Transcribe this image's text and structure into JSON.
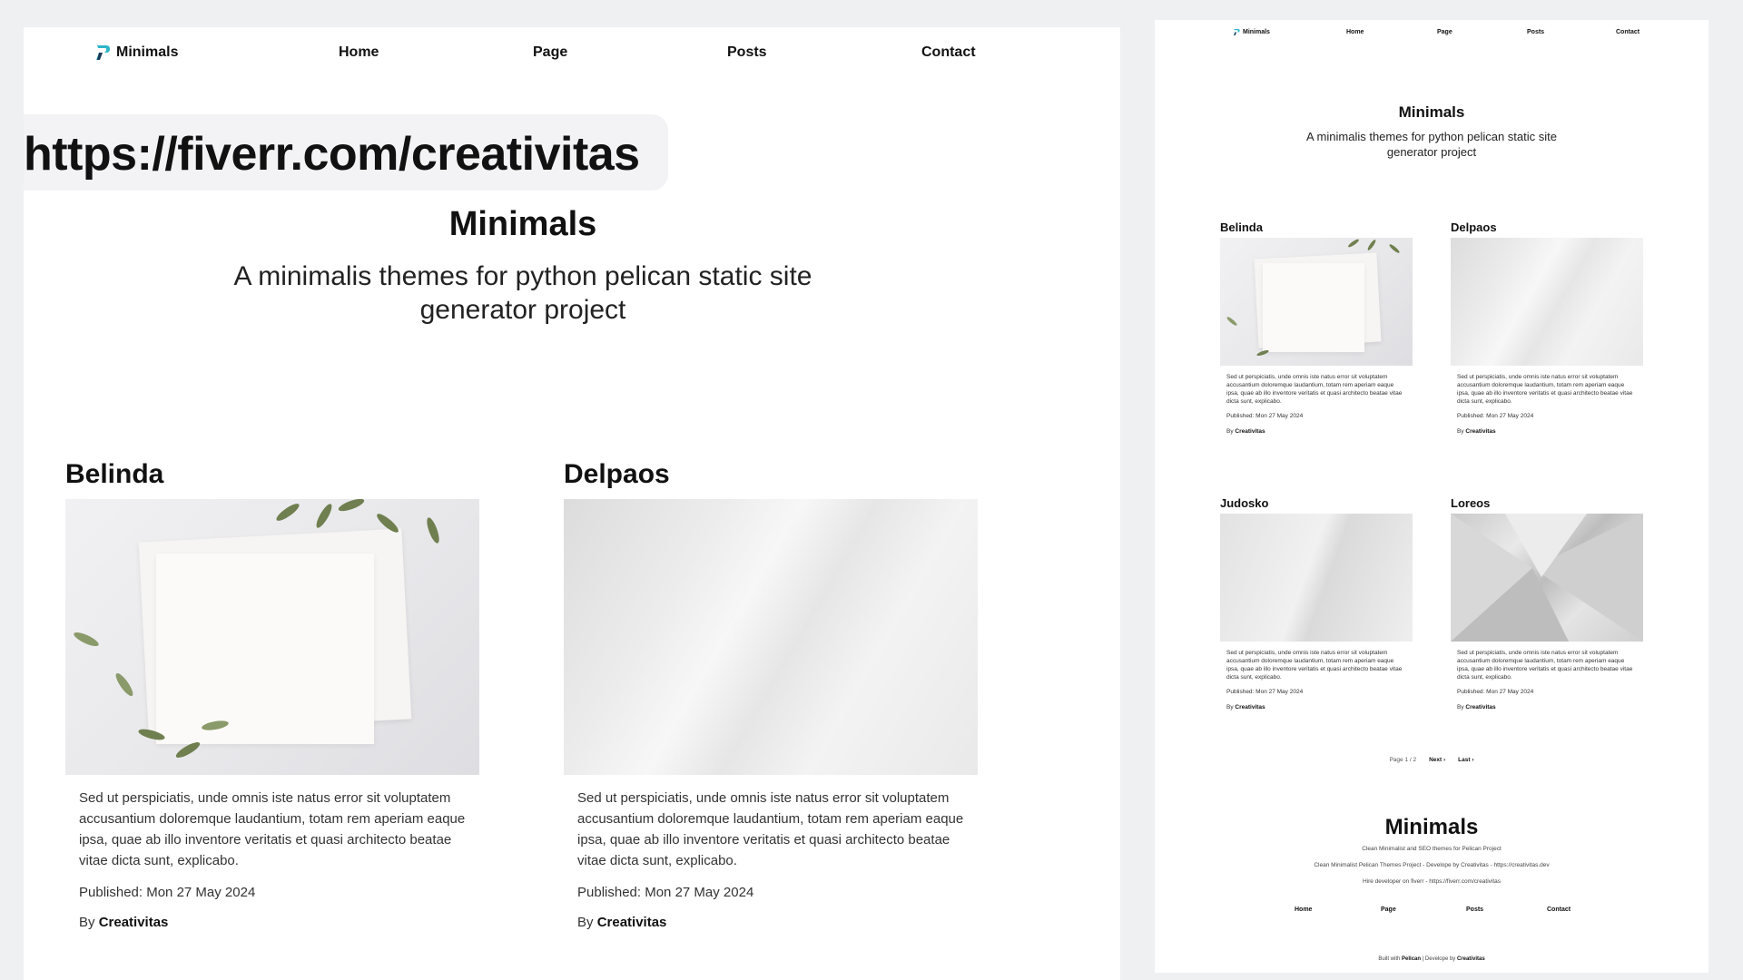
{
  "brand": {
    "name": "Minimals"
  },
  "nav": [
    "Home",
    "Page",
    "Posts",
    "Contact"
  ],
  "banner": {
    "url": "https://fiverr.com/creativitas"
  },
  "hero": {
    "title": "Minimals",
    "subtitle": "A minimalis themes for python pelican static site generator project"
  },
  "posts": [
    {
      "title": "Belinda",
      "image": "paper-leaves",
      "excerpt": "Sed ut perspiciatis, unde omnis iste natus error sit voluptatem accusantium doloremque laudantium, totam rem aperiam eaque ipsa, quae ab illo inventore veritatis et quasi architecto beatae vitae dicta sunt, explicabo.",
      "published": "Published: Mon 27 May 2024",
      "by_prefix": "By",
      "author": "Creativitas"
    },
    {
      "title": "Delpaos",
      "image": "white-curve",
      "excerpt": "Sed ut perspiciatis, unde omnis iste natus error sit voluptatem accusantium doloremque laudantium, totam rem aperiam eaque ipsa, quae ab illo inventore veritatis et quasi architecto beatae vitae dicta sunt, explicabo.",
      "published": "Published: Mon 27 May 2024",
      "by_prefix": "By",
      "author": "Creativitas"
    },
    {
      "title": "Judosko",
      "image": "white-wall",
      "excerpt": "Sed ut perspiciatis, unde omnis iste natus error sit voluptatem accusantium doloremque laudantium, totam rem aperiam eaque ipsa, quae ab illo inventore veritatis et quasi architecto beatae vitae dicta sunt, explicabo.",
      "published": "Published: Mon 27 May 2024",
      "by_prefix": "By",
      "author": "Creativitas"
    },
    {
      "title": "Loreos",
      "image": "grey-polygons",
      "excerpt": "Sed ut perspiciatis, unde omnis iste natus error sit voluptatem accusantium doloremque laudantium, totam rem aperiam eaque ipsa, quae ab illo inventore veritatis et quasi architecto beatae vitae dicta sunt, explicabo.",
      "published": "Published: Mon 27 May 2024",
      "by_prefix": "By",
      "author": "Creativitas"
    }
  ],
  "pagination": {
    "status": "Page 1 / 2",
    "next": "Next",
    "last": "Last"
  },
  "footer": {
    "title": "Minimals",
    "tagline": "Clean Minimalist and SEO themes for Pelican Project",
    "project_line": "Clean Minimalist Pelican Themes Project - Develope by Creativitas - https://creativitas.dev",
    "hire_line": "Hire developer on fiverr - https://fiverr.com/creativitas",
    "links": [
      "Home",
      "Page",
      "Posts",
      "Contact"
    ],
    "built_prefix": "Built with",
    "built_tool": "Pelican",
    "built_mid": "| Develope by",
    "built_author": "Creativitas"
  },
  "colors": {
    "logo_teal": "#2bb5c9",
    "logo_dark": "#1b3a57",
    "text": "#111111",
    "page_bg": "#eff0f2",
    "panel_bg": "#ffffff"
  }
}
